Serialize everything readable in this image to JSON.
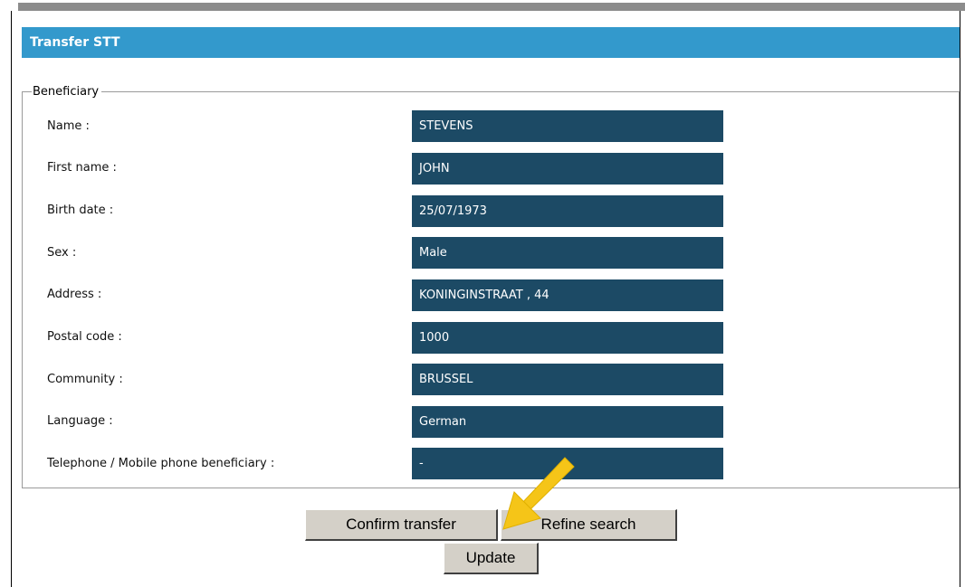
{
  "header": {
    "title": "Transfer STT"
  },
  "beneficiary": {
    "legend": "Beneficiary",
    "rows": [
      {
        "label": "Name :",
        "value": "STEVENS"
      },
      {
        "label": "First name :",
        "value": "JOHN"
      },
      {
        "label": "Birth date :",
        "value": "25/07/1973"
      },
      {
        "label": "Sex :",
        "value": "Male"
      },
      {
        "label": "Address :",
        "value": "KONINGINSTRAAT , 44"
      },
      {
        "label": "Postal code :",
        "value": "1000"
      },
      {
        "label": "Community :",
        "value": "BRUSSEL"
      },
      {
        "label": "Language :",
        "value": "German"
      },
      {
        "label": "Telephone / Mobile phone beneficiary :",
        "value": "-"
      }
    ]
  },
  "buttons": {
    "confirm_label": "Confirm transfer",
    "refine_label": "Refine search",
    "update_label": "Update"
  },
  "colors": {
    "header_bg": "#3399cc",
    "value_bg": "#1c4a65",
    "button_bg": "#d4d0c8",
    "annotation_arrow": "#f5c518"
  },
  "icons": {
    "annotation": "pointer-arrow-icon"
  }
}
